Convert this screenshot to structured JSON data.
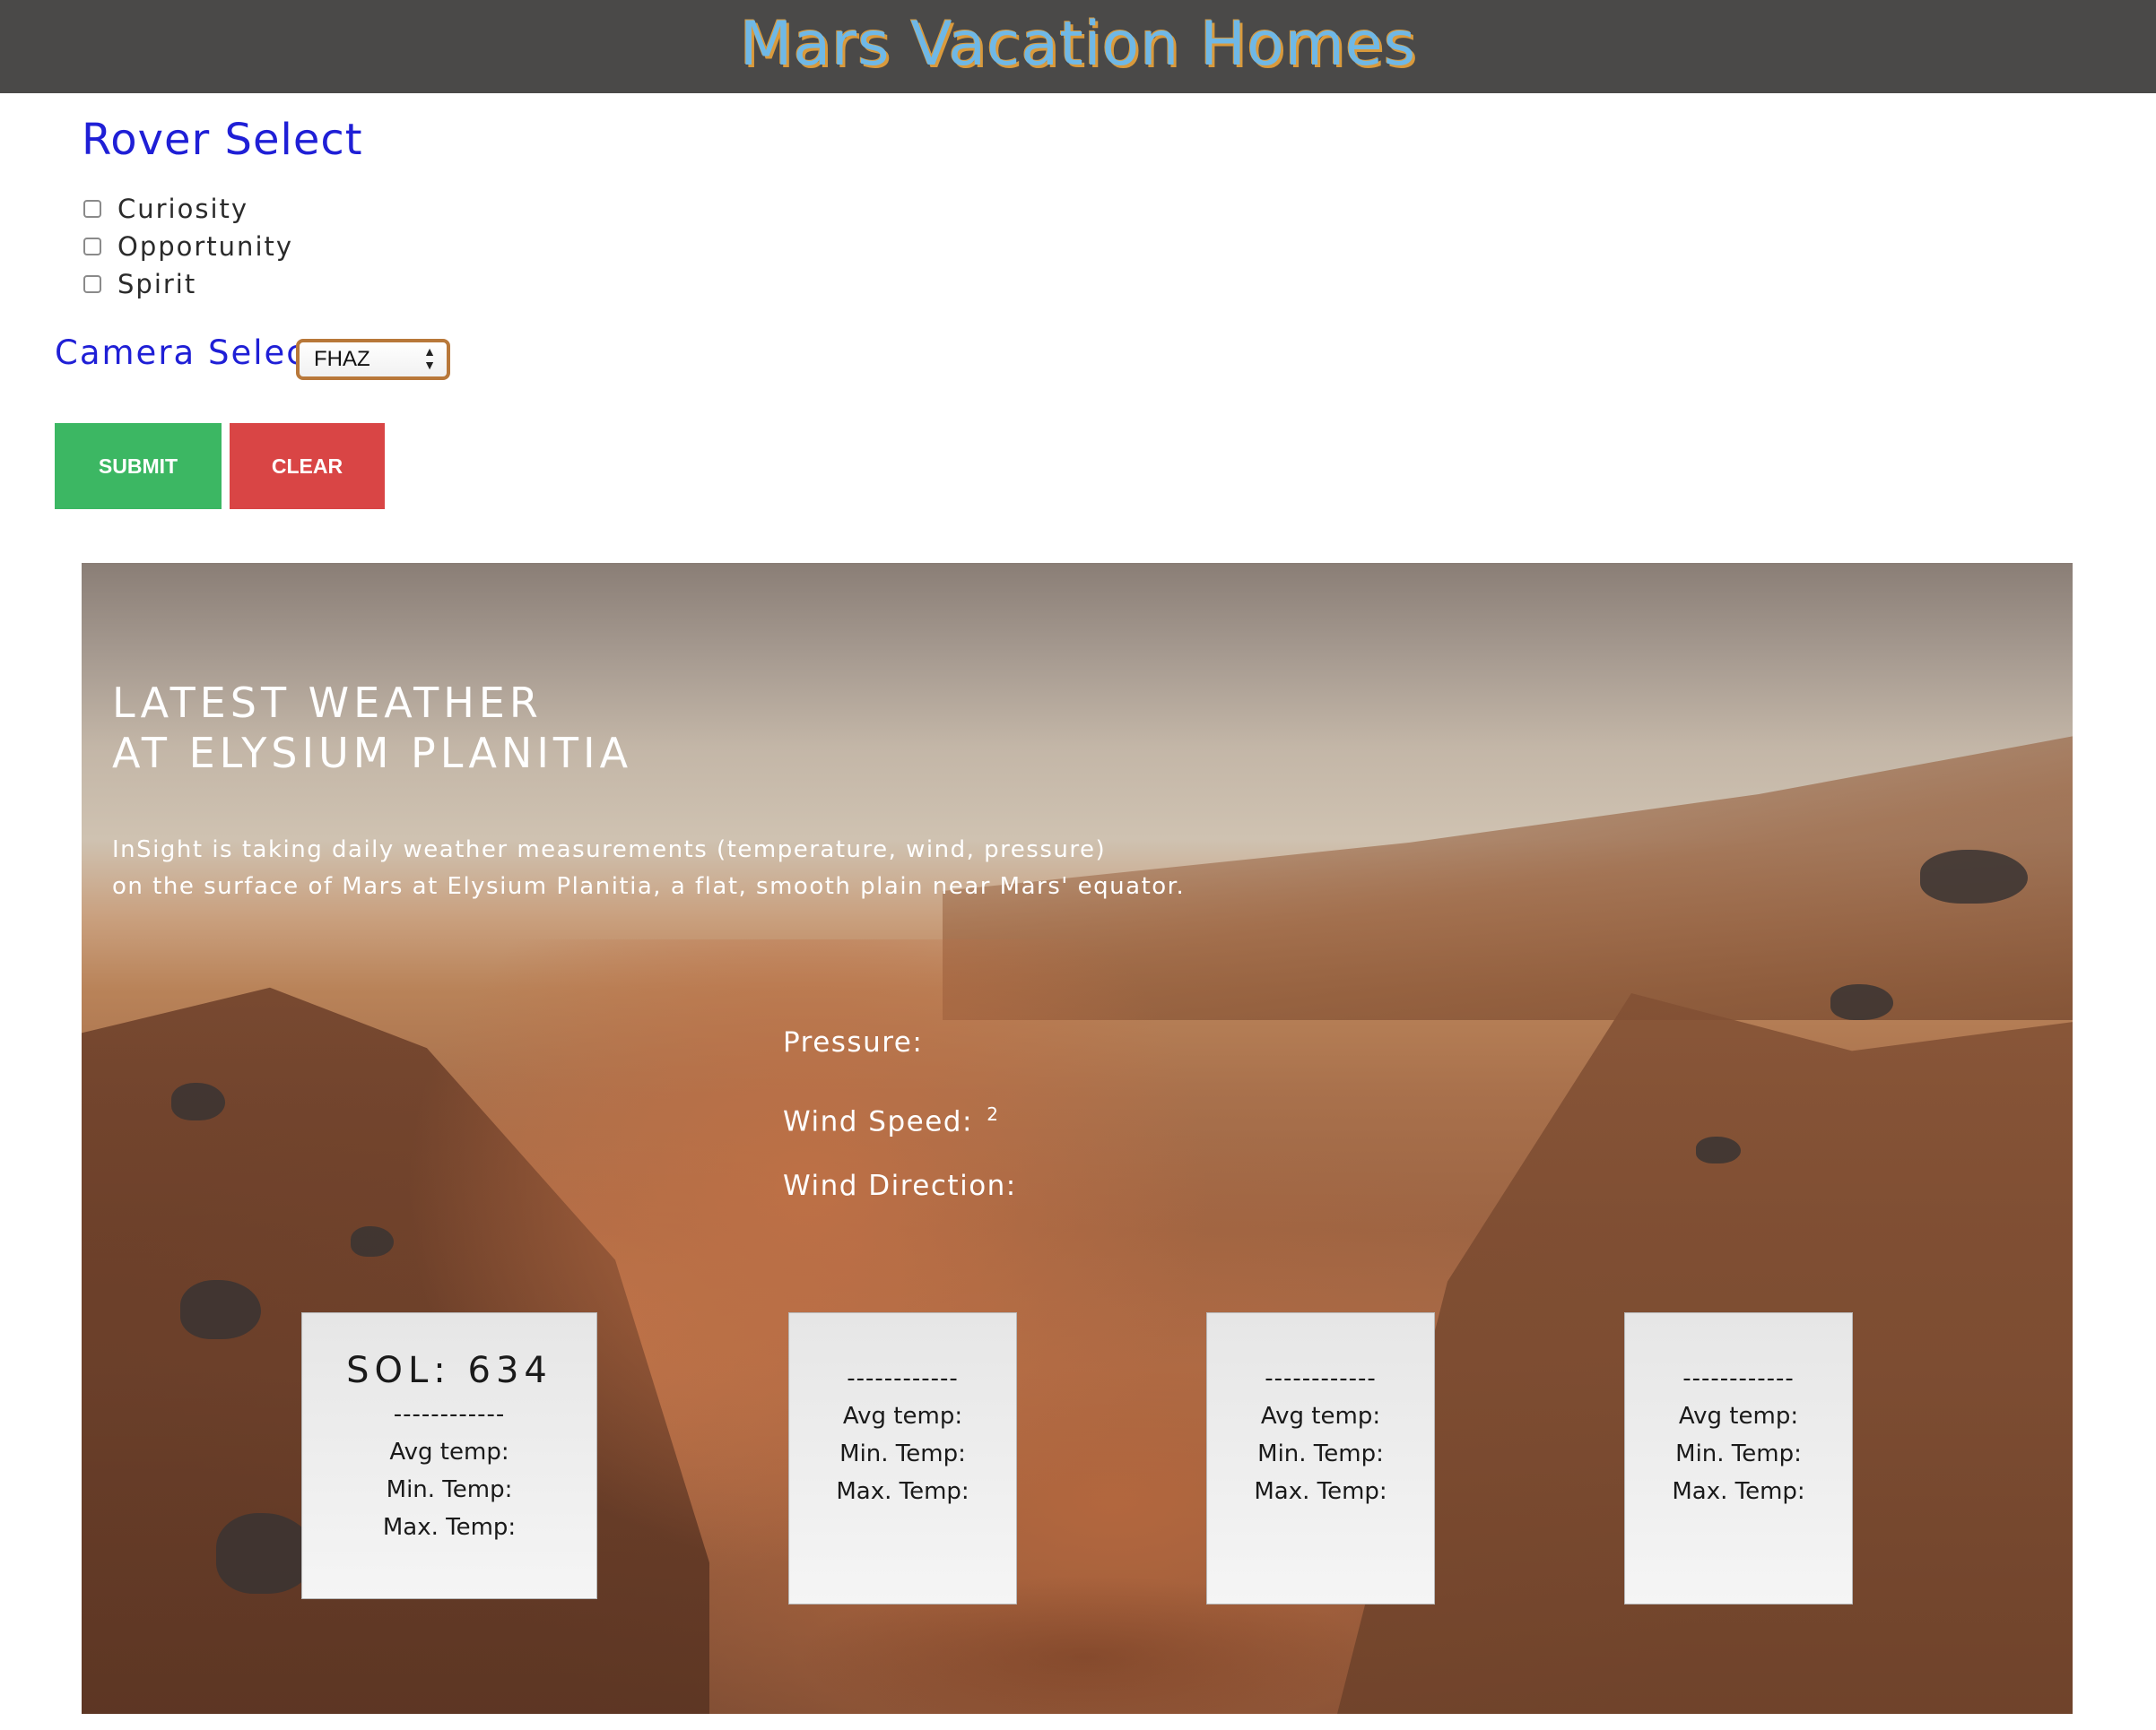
{
  "header": {
    "title": "Mars Vacation Homes"
  },
  "rover_select": {
    "title": "Rover Select",
    "options": [
      {
        "label": "Curiosity",
        "checked": false
      },
      {
        "label": "Opportunity",
        "checked": false
      },
      {
        "label": "Spirit",
        "checked": false
      }
    ]
  },
  "camera_select": {
    "label": "Camera Select",
    "selected": "FHAZ"
  },
  "buttons": {
    "submit": "SUBMIT",
    "clear": "CLEAR"
  },
  "weather": {
    "title_line1": "LATEST WEATHER",
    "title_line2": "AT ELYSIUM PLANITIA",
    "desc_line1": "InSight is taking daily weather measurements (temperature, wind, pressure)",
    "desc_line2": "on the surface of Mars at Elysium Planitia, a flat, smooth plain near Mars' equator.",
    "pressure_label": "Pressure:",
    "wind_speed_label": "Wind Speed:",
    "wind_speed_sup": "2",
    "wind_direction_label": "Wind Direction:",
    "cards": [
      {
        "sol": "SOL: 634",
        "divider": "------------",
        "avg": "Avg temp:",
        "min": "Min. Temp:",
        "max": "Max. Temp:"
      },
      {
        "divider": "------------",
        "avg": "Avg temp:",
        "min": "Min. Temp:",
        "max": "Max. Temp:"
      },
      {
        "divider": "------------",
        "avg": "Avg temp:",
        "min": "Min. Temp:",
        "max": "Max. Temp:"
      },
      {
        "divider": "------------",
        "avg": "Avg temp:",
        "min": "Min. Temp:",
        "max": "Max. Temp:"
      }
    ]
  },
  "colors": {
    "header_bg": "#4a4948",
    "title_blue": "#6fb8e6",
    "title_shadow": "#d99a3c",
    "heading_blue": "#1f1fd6",
    "submit_green": "#3cb763",
    "clear_red": "#d94545",
    "select_border": "#b8783a"
  }
}
